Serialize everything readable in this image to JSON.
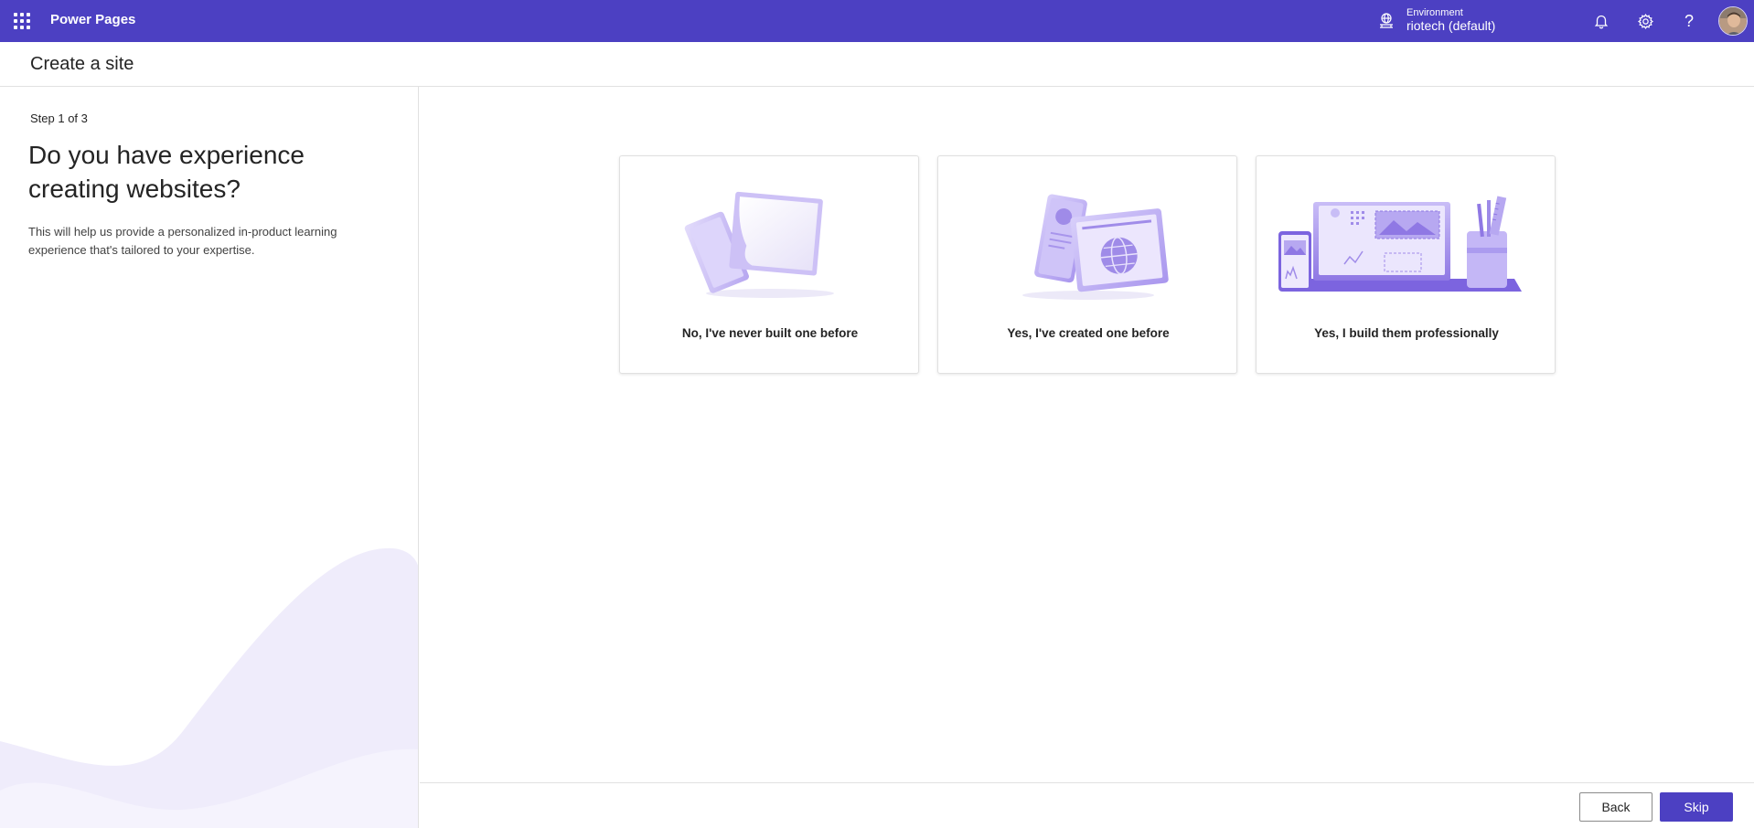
{
  "topbar": {
    "app_name": "Power Pages",
    "environment_label": "Environment",
    "environment_value": "riotech (default)",
    "icons": [
      "waffle-icon",
      "environment-icon",
      "bell-icon",
      "gear-icon",
      "help-icon"
    ],
    "help_glyph": "?",
    "color": "#4c40c2"
  },
  "page": {
    "title": "Create a site"
  },
  "left": {
    "step": "Step 1 of 3",
    "question": "Do you have experience creating websites?",
    "description": "This will help us provide a personalized in-product learning experience that's tailored to your expertise."
  },
  "options": [
    {
      "label": "No, I've never built one before",
      "illustration": "paper-sheets"
    },
    {
      "label": "Yes, I've created one before",
      "illustration": "phone-and-browser-globe"
    },
    {
      "label": "Yes, I build them professionally",
      "illustration": "devices-and-pencil-cup"
    }
  ],
  "footer": {
    "back_label": "Back",
    "skip_label": "Skip",
    "accent": "#4c40c2"
  }
}
